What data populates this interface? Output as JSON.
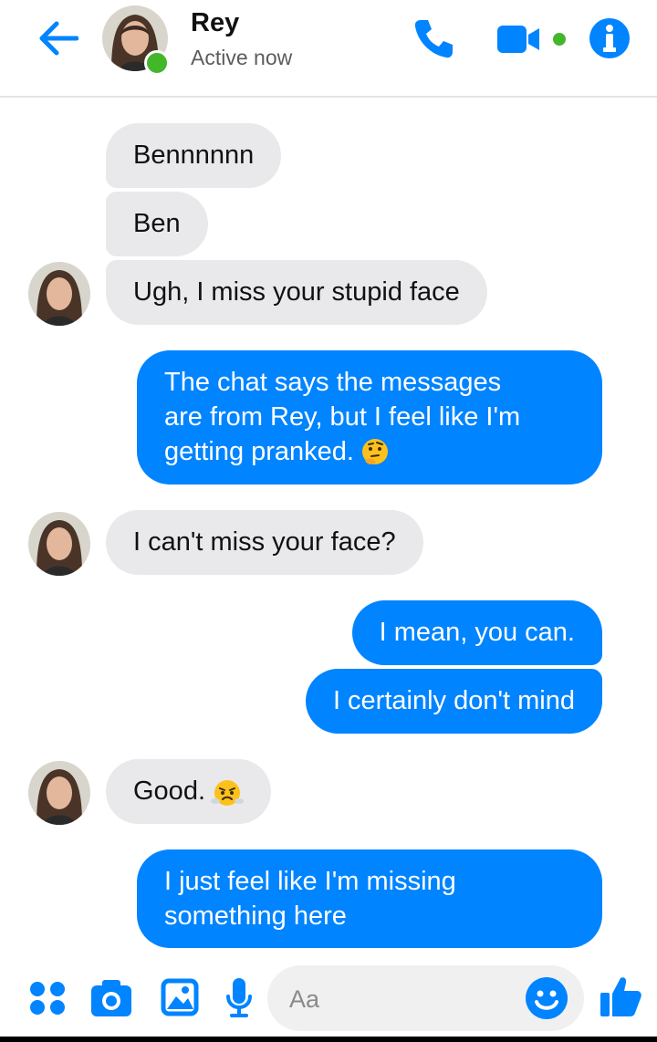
{
  "header": {
    "contact_name": "Rey",
    "status": "Active now"
  },
  "messages": [
    {
      "from": "them",
      "text": "Bennnnnn"
    },
    {
      "from": "them",
      "text": "Ben"
    },
    {
      "from": "them",
      "text": "Ugh, I miss your stupid face"
    },
    {
      "from": "me",
      "lines": [
        "The chat says the messages",
        "are from Rey, but I feel like I'm",
        "getting pranked."
      ],
      "emoji": "thinking-face"
    },
    {
      "from": "them",
      "text": "I can't miss your face?"
    },
    {
      "from": "me",
      "text": "I mean, you can."
    },
    {
      "from": "me",
      "text": "I certainly don't mind"
    },
    {
      "from": "them",
      "text": "Good.",
      "emoji": "face-with-steam"
    },
    {
      "from": "me",
      "lines": [
        "I just feel like I'm missing",
        "something here"
      ]
    }
  ],
  "composer": {
    "placeholder": "Aa",
    "icons": [
      "menu-dots-icon",
      "camera-icon",
      "gallery-icon",
      "microphone-icon",
      "smiley-icon",
      "thumbs-up-icon"
    ]
  },
  "colors": {
    "accent": "#0084ff",
    "incoming_bubble": "#e9e9eb",
    "presence": "#42b72a"
  }
}
